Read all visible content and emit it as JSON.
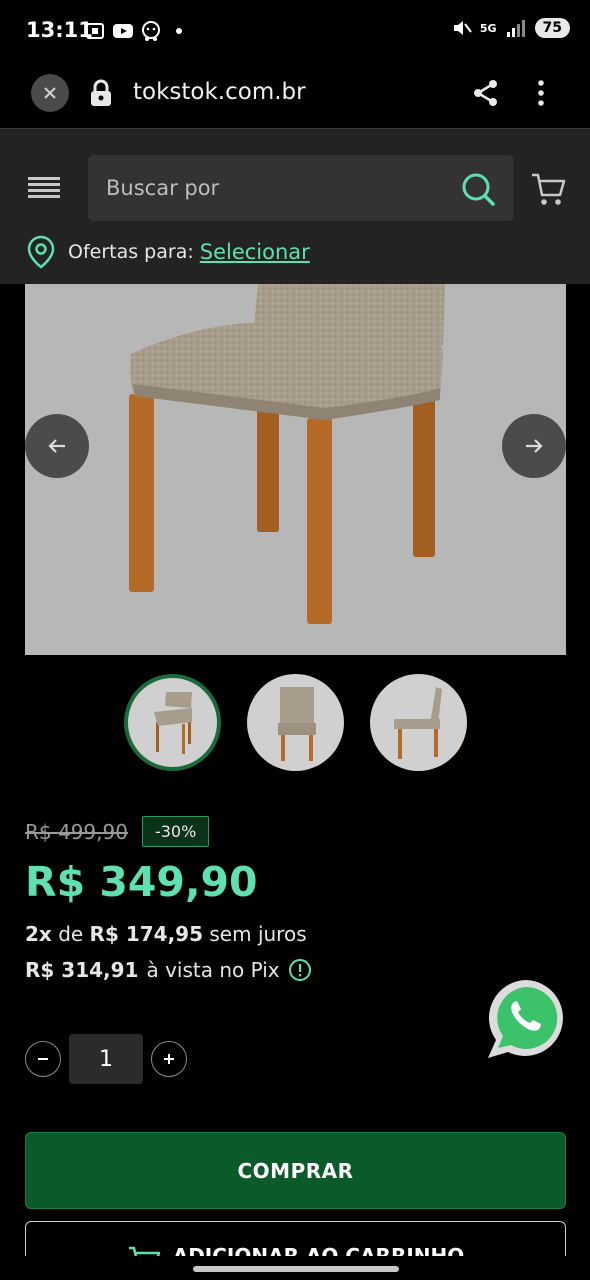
{
  "status_bar": {
    "time": "13:11",
    "battery": "75",
    "network": "5G"
  },
  "browser": {
    "url": "tokstok.com.br"
  },
  "header": {
    "search_placeholder": "Buscar por",
    "offers_label": "Ofertas para:",
    "offers_link": "Selecionar"
  },
  "product": {
    "old_price": "R$ 499,90",
    "discount": "-30%",
    "price": "R$ 349,90",
    "installments_count": "2x",
    "installments_of": "de",
    "installment_value": "R$ 174,95",
    "installments_suffix": "sem juros",
    "pix_price": "R$ 314,91",
    "pix_label": "à vista no Pix",
    "quantity": "1"
  },
  "actions": {
    "buy_label": "COMPRAR",
    "add_to_cart_label": "ADICIONAR AO CARRINHO"
  },
  "colors": {
    "accent": "#5ee0b0",
    "buy_button": "#0b5a2a",
    "header_bg": "#232323"
  }
}
